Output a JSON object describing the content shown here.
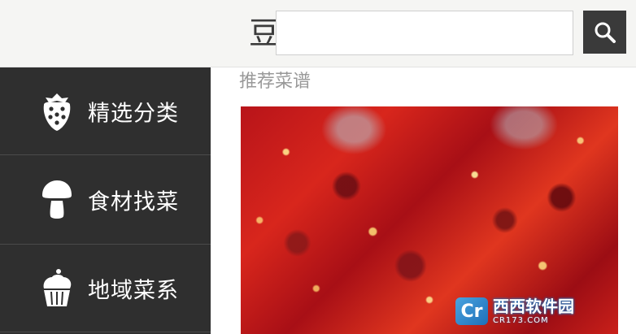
{
  "header": {
    "logo_text": "豆",
    "search": {
      "value": "",
      "placeholder": ""
    },
    "search_icon": "search-icon"
  },
  "sidebar": {
    "items": [
      {
        "label": "精选分类",
        "icon": "strawberry-icon"
      },
      {
        "label": "食材找菜",
        "icon": "mushroom-icon"
      },
      {
        "label": "地域菜系",
        "icon": "cupcake-icon"
      }
    ]
  },
  "main": {
    "title": "推荐菜谱",
    "recipe_image": {
      "description_icon": "chili-sauce-photo"
    },
    "watermark": {
      "logo": "Cr",
      "text": "西西软件园",
      "sub": "CR173.COM"
    }
  },
  "colors": {
    "header_bg": "#f5f5f3",
    "sidebar_bg": "#2f2f2f",
    "search_button_bg": "#3a3a3a",
    "title_color": "#999999"
  }
}
